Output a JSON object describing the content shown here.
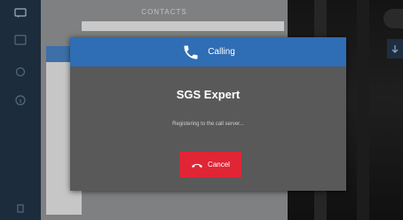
{
  "contacts": {
    "title": "CONTACTS"
  },
  "dialog": {
    "header_label": "Calling",
    "header_icon": "phone-icon",
    "contact_name": "SGS Expert",
    "status": "Registering to the call server...",
    "cancel_label": "Cancel",
    "cancel_icon": "hang-up-icon"
  },
  "colors": {
    "header_blue": "#2f6db5",
    "cancel_red": "#e02535",
    "dialog_bg": "#595959",
    "rail_bg": "#1d2c3c"
  }
}
